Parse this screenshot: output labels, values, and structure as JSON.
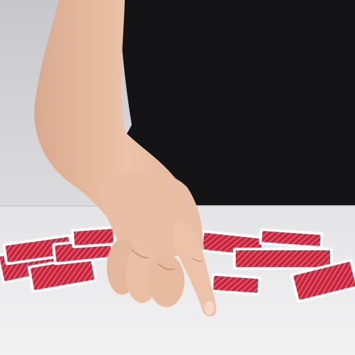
{
  "scene": {
    "subject": "hand-spreading-playing-cards",
    "colors": {
      "backdrop": "#d4d4d8",
      "shirt": "#141416",
      "table": "#eeeeef",
      "skin": "#e8bfa4",
      "skin_shadow": "#c9987c",
      "card_back": "#c8253c",
      "card_border": "#ffffff"
    }
  }
}
